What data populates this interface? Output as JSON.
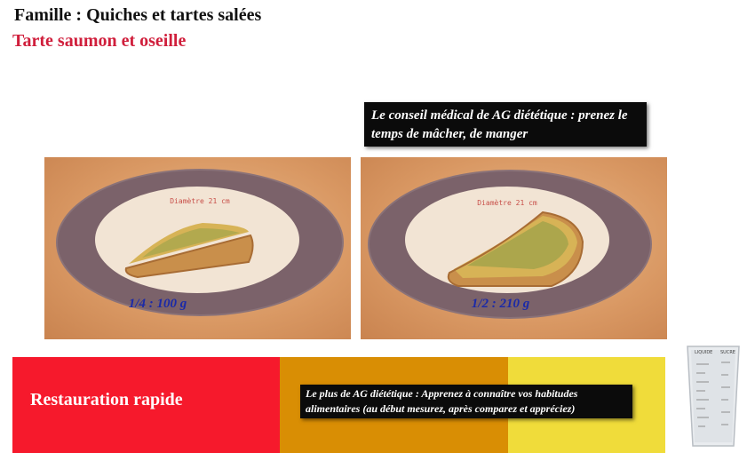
{
  "header": {
    "family": "Famille : Quiches et tartes salées",
    "recipe": "Tarte saumon et oseille"
  },
  "photos": [
    {
      "portion_label": "1/4 : 100 g",
      "plate_text": "Diamètre 21 cm"
    },
    {
      "portion_label": "1/2 : 210 g",
      "plate_text": "Diamètre 21 cm"
    }
  ],
  "advice": {
    "conseil": "Le conseil médical de AG diététique : prenez le temps de mâcher, de manger",
    "plus": "Le plus de AG diététique : Apprenez à connaître vos habitudes alimentaires (au début mesurez, après comparez et appréciez)"
  },
  "category_band": {
    "label": "Restauration rapide",
    "colors": [
      "#f6192c",
      "#d98e04",
      "#f0dc3a"
    ]
  },
  "measuring_cup": {
    "labels": [
      "LIQUIDE",
      "SUCRE"
    ]
  },
  "colors": {
    "recipe_title": "#d01f3c",
    "portion_label": "#1b2aa8",
    "advice_bg": "#0b0b0b"
  }
}
